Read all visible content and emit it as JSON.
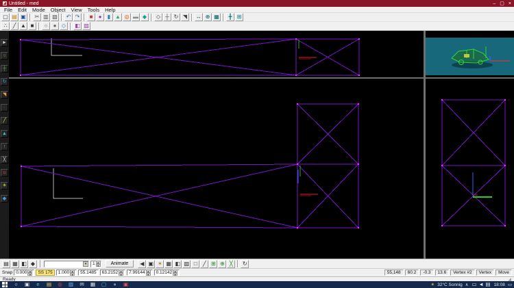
{
  "window": {
    "title": "Untitled - med",
    "minimize": "–",
    "maximize": "▢",
    "close": "×"
  },
  "menu": [
    "File",
    "Edit",
    "Mode",
    "Object",
    "View",
    "Tools",
    "Help"
  ],
  "toolbar_row1": [
    {
      "n": "new",
      "g": "▢",
      "c": "#34495e"
    },
    {
      "n": "open",
      "g": "▤",
      "c": "#b8860b"
    },
    {
      "n": "save",
      "g": "▣",
      "c": "#1f4fa0"
    },
    "|",
    {
      "n": "cut",
      "g": "✂",
      "c": "#555555"
    },
    {
      "n": "copy",
      "g": "▥",
      "c": "#555555"
    },
    {
      "n": "paste",
      "g": "▧",
      "c": "#555555"
    },
    "|",
    {
      "n": "undo",
      "g": "↶",
      "c": "#2e6da4"
    },
    {
      "n": "redo",
      "g": "↷",
      "c": "#2e6da4"
    },
    "|",
    {
      "n": "box",
      "g": "■",
      "c": "#c0392b"
    },
    {
      "n": "sphere",
      "g": "●",
      "c": "#8e44ad"
    },
    {
      "n": "cylinder",
      "g": "▮",
      "c": "#2980b9"
    },
    {
      "n": "cone",
      "g": "▲",
      "c": "#27ae60"
    },
    {
      "n": "torus",
      "g": "◎",
      "c": "#d35400"
    },
    {
      "n": "plane",
      "g": "▬",
      "c": "#7f8c8d"
    },
    {
      "n": "geosphere",
      "g": "◆",
      "c": "#16a085"
    },
    "|",
    {
      "n": "select",
      "g": "◇",
      "c": "#444444"
    },
    {
      "n": "move",
      "g": "┼",
      "c": "#444444"
    },
    {
      "n": "rotate",
      "g": "↻",
      "c": "#444444"
    },
    {
      "n": "scale",
      "g": "◥",
      "c": "#444444"
    },
    "|",
    {
      "n": "mirror",
      "g": "↔",
      "c": "#006666"
    },
    {
      "n": "weld",
      "g": "⊕",
      "c": "#006666"
    },
    {
      "n": "snap-grid",
      "g": "▦",
      "c": "#006666"
    },
    "|",
    {
      "n": "axes",
      "g": "╋",
      "c": "#008080"
    },
    {
      "n": "fit-view",
      "g": "⊞",
      "c": "#008080"
    }
  ],
  "toolbar_row2": [
    {
      "n": "vertex-mode",
      "g": "∴",
      "c": "#333333"
    },
    {
      "n": "edge-mode",
      "g": "╱",
      "c": "#333333"
    },
    {
      "n": "face-mode",
      "g": "▲",
      "c": "#333333"
    },
    {
      "n": "object-mode",
      "g": "■",
      "c": "#333333"
    },
    "|",
    {
      "n": "hide",
      "g": "○",
      "c": "#666666"
    },
    {
      "n": "show",
      "g": "●",
      "c": "#666666"
    },
    {
      "n": "freeze",
      "g": "◇",
      "c": "#3a7ab0"
    },
    "|",
    {
      "n": "material",
      "g": "◧",
      "c": "#9a4aa0"
    },
    {
      "n": "texture",
      "g": "▨",
      "c": "#9a4aa0"
    }
  ],
  "left_toolbar": [
    {
      "n": "select-arrow",
      "g": "►",
      "c": "#d0d0d0"
    },
    {
      "n": "select-lasso",
      "g": "○",
      "c": "#d0a040"
    },
    {
      "n": "move-tool",
      "g": "┼",
      "c": "#40c040"
    },
    {
      "n": "rotate-tool",
      "g": "↻",
      "c": "#40a0e0"
    },
    {
      "n": "scale-tool",
      "g": "◥",
      "c": "#e0a040"
    },
    {
      "n": "vertex-tool",
      "g": "∙",
      "c": "#e04040"
    },
    {
      "n": "edge-tool",
      "g": "╱",
      "c": "#e0e040"
    },
    {
      "n": "face-tool",
      "g": "▲",
      "c": "#40c0c0"
    },
    {
      "n": "extrude-tool",
      "g": "↑",
      "c": "#c080ff"
    },
    {
      "n": "knife-tool",
      "g": "╳",
      "c": "#d0d0d0"
    },
    {
      "n": "magnet-tool",
      "g": "∪",
      "c": "#e04040"
    },
    {
      "n": "light-tool",
      "g": "☀",
      "c": "#e0e040"
    },
    {
      "n": "camera-tool",
      "g": "◆",
      "c": "#40a0e0"
    }
  ],
  "bottom_bar": {
    "icons_left": [
      {
        "n": "layers",
        "g": "▤",
        "c": "#333333"
      },
      {
        "n": "grid-toggle",
        "g": "▦",
        "c": "#333333"
      },
      {
        "n": "mirror-toggle",
        "g": "◧",
        "c": "#333333"
      },
      {
        "n": "keyframe",
        "g": "◆",
        "c": "#333333"
      }
    ],
    "frame_value": "1",
    "animate_label": "Animate",
    "icons_mid": [
      {
        "n": "mute",
        "g": "◀",
        "c": "#333333"
      },
      {
        "n": "screenshot",
        "g": "▣",
        "c": "#333333"
      },
      {
        "n": "flashlight",
        "g": "✶",
        "c": "#b08020"
      },
      {
        "n": "wireframe-toggle",
        "g": "▦",
        "c": "#333333"
      },
      {
        "n": "shaded-toggle",
        "g": "◧",
        "c": "#333333"
      },
      {
        "n": "textured-toggle",
        "g": "▨",
        "c": "#333333"
      },
      {
        "n": "bounds-toggle",
        "g": "□",
        "c": "#333333"
      },
      {
        "n": "normals-toggle",
        "g": "╱",
        "c": "#333333"
      },
      {
        "n": "grid-snap",
        "g": "⊞",
        "c": "#2a8a2a"
      },
      {
        "n": "point-snap",
        "g": "⊕",
        "c": "#2a8a2a"
      },
      {
        "n": "cross-snap",
        "g": "╳",
        "c": "#2a8a2a"
      },
      "|",
      {
        "n": "refresh",
        "g": "↻",
        "c": "#333333"
      }
    ]
  },
  "coord_bar": {
    "snap_label": "Snap",
    "snap_step": "0.000",
    "snap_chip": "SS 175",
    "snap_scale": "1.000",
    "coord_x": "55.1485",
    "coord_y": "63.2152",
    "coord_z": "7.99144",
    "coord_w": "0.12142"
  },
  "status_panels": [
    "55,148",
    "60.2",
    "-0.3",
    "13.6",
    "Vertex #2",
    "Vertex",
    "Move"
  ],
  "ready_bar": {
    "text": "Ready"
  },
  "taskbar": {
    "apps": [
      {
        "n": "search",
        "g": "○",
        "c": "#e8e8e8"
      },
      {
        "n": "task-view",
        "g": "▣",
        "c": "#e8e8e8"
      },
      {
        "n": "edge",
        "g": "e",
        "c": "#4fc3f7"
      },
      {
        "n": "explorer",
        "g": "▤",
        "c": "#ffd54f"
      },
      {
        "n": "chrome",
        "g": "◎",
        "c": "#ef5350"
      },
      {
        "n": "photos",
        "g": "▨",
        "c": "#64b5f6"
      },
      {
        "n": "mail",
        "g": "✉",
        "c": "#e8e8e8"
      },
      {
        "n": "store",
        "g": "▦",
        "c": "#e8e8e8"
      },
      {
        "n": "vscode",
        "g": "▢",
        "c": "#4fc3f7"
      },
      {
        "n": "discord",
        "g": "●",
        "c": "#7986cb"
      },
      {
        "n": "med-app",
        "g": "▣",
        "c": "#ef5350"
      }
    ],
    "sun": "☀",
    "weather": "32°C  Sonnig",
    "chevron": "∧",
    "tray": [
      {
        "n": "tray-window",
        "g": "▭",
        "c": "#e8e8e8"
      },
      {
        "n": "tray-volume",
        "g": "◄",
        "c": "#e8e8e8"
      },
      {
        "n": "tray-keyboard",
        "g": "▤",
        "c": "#e8e8e8"
      }
    ],
    "time": "18:08",
    "action_center": "▭"
  },
  "ui": {
    "spin_up": "▴",
    "spin_down": "▾",
    "combo_arrow": "▾",
    "grip": "◢"
  },
  "colors": {
    "titlebar": "#8a1526",
    "wireframe": "#7a14cc",
    "vertex_marker": "#ff2cff",
    "viewport_bg": "#000000",
    "preview_bg": "#17687a",
    "model_green": "#35d435",
    "axis_red": "#e02020",
    "axis_green": "#18b018",
    "axis_blue": "#2f5fff",
    "taskbar": "#14294b",
    "snap_highlight": "#ffe97a"
  }
}
